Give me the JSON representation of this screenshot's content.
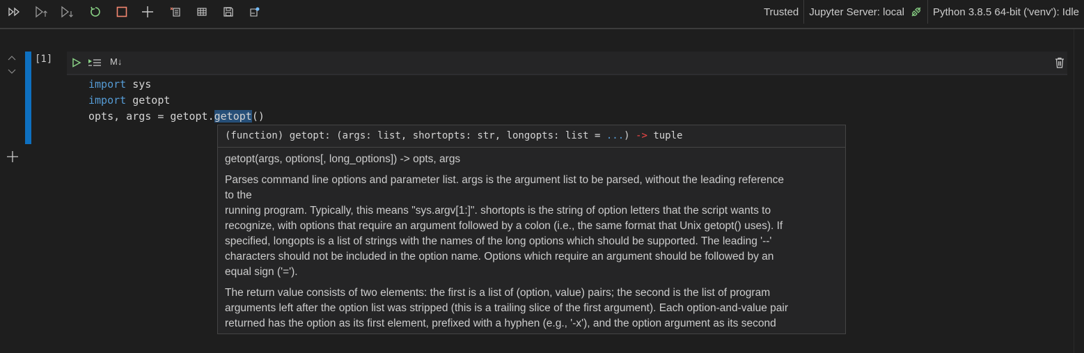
{
  "toolbar": {
    "buttons": [
      {
        "name": "run-all-icon",
        "color": "#cccccc"
      },
      {
        "name": "run-above-icon",
        "color": "#cccccc"
      },
      {
        "name": "run-below-icon",
        "color": "#cccccc"
      },
      {
        "name": "restart-kernel-icon",
        "color": "#89d185"
      },
      {
        "name": "interrupt-kernel-icon",
        "color": "#f48771"
      },
      {
        "name": "add-cell-icon",
        "color": "#cccccc"
      },
      {
        "name": "clear-outputs-icon",
        "color": "#cccccc"
      },
      {
        "name": "variables-icon",
        "color": "#cccccc"
      },
      {
        "name": "save-icon",
        "color": "#cccccc"
      },
      {
        "name": "export-icon",
        "color": "#cccccc"
      }
    ]
  },
  "status": {
    "trusted": "Trusted",
    "server": "Jupyter Server: local",
    "kernel": "Python 3.8.5 64-bit ('venv'): Idle"
  },
  "cell": {
    "execution_count": "[1]",
    "markdown_toggle": "M↓",
    "code_lines": {
      "line1_kw": "import",
      "line1_rest": " sys",
      "line2_kw": "import",
      "line2_rest": " getopt",
      "line3_pre": "opts, args = getopt.",
      "line3_hl": "getopt",
      "line3_post": "()"
    },
    "accent_color": "#0e70c0"
  },
  "hover": {
    "signature_pre": "(function) getopt: (args: list, shortopts: str, longopts: list = ",
    "signature_dots": "...",
    "signature_mid": ") ",
    "signature_arrow": "->",
    "signature_post": " tuple",
    "usage": "getopt(args, options[, long_options]) -> opts, args",
    "para1_lines": [
      "Parses command line options and parameter list. args is the argument list to be parsed, without the leading reference",
      "to the",
      "running program. Typically, this means \"sys.argv[1:]\". shortopts is the string of option letters that the script wants to",
      "recognize, with options that require an argument followed by a colon (i.e., the same format that Unix getopt() uses). If",
      "specified, longopts is a list of strings with the names of the long options which should be supported. The leading '--'",
      "characters should not be included in the option name. Options which require an argument should be followed by an",
      "equal sign ('=')."
    ],
    "para2_lines": [
      "The return value consists of two elements: the first is a list of (option, value) pairs; the second is the list of program",
      "arguments left after the option list was stripped (this is a trailing slice of the first argument). Each option-and-value pair",
      "returned has the option as its first element, prefixed with a hyphen (e.g., '-x'), and the option argument as its second"
    ]
  }
}
